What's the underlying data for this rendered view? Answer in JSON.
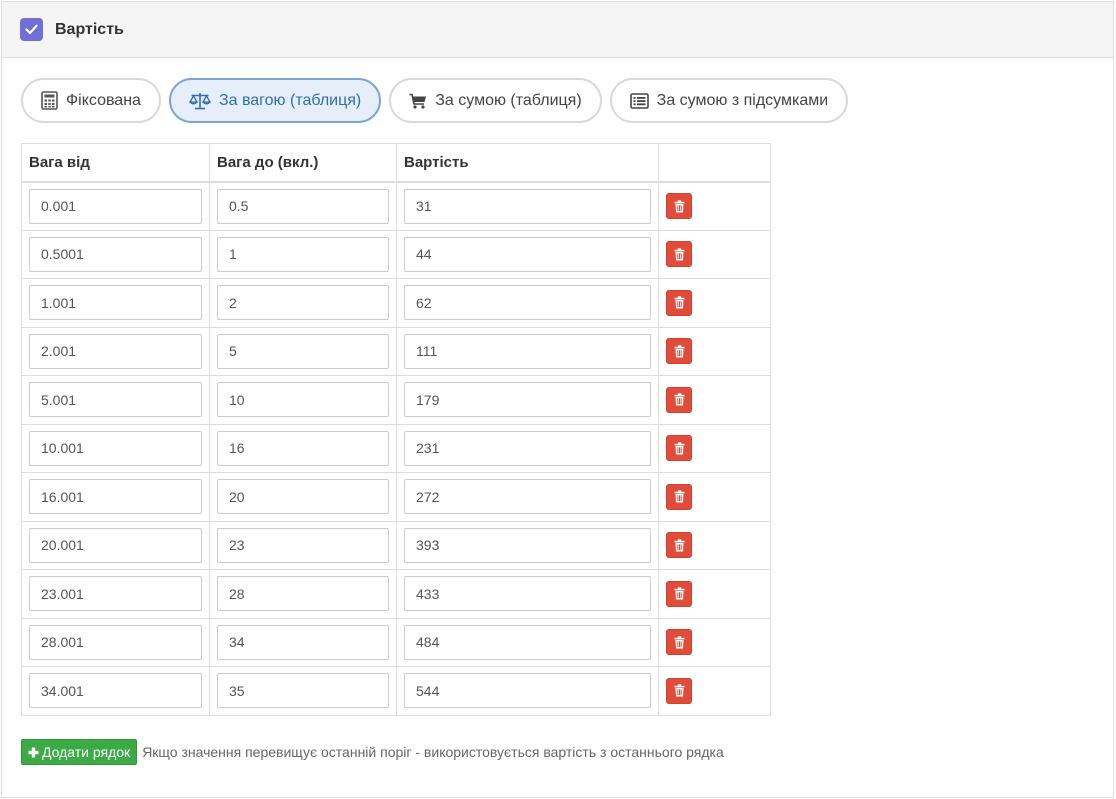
{
  "panel": {
    "title": "Вартість",
    "checked": true,
    "check_icon": "checkmark-icon"
  },
  "tabs": [
    {
      "label": "Фіксована",
      "icon": "calculator-icon",
      "active": false
    },
    {
      "label": "За вагою (таблиця)",
      "icon": "balance-scale-icon",
      "active": true
    },
    {
      "label": "За сумою (таблиця)",
      "icon": "shopping-cart-icon",
      "active": false
    },
    {
      "label": "За сумою з підсумками",
      "icon": "list-alt-icon",
      "active": false
    }
  ],
  "table": {
    "headers": [
      "Вага від",
      "Вага до (вкл.)",
      "Вартість",
      ""
    ],
    "rows": [
      {
        "from": "0.001",
        "to": "0.5",
        "cost": "31"
      },
      {
        "from": "0.5001",
        "to": "1",
        "cost": "44"
      },
      {
        "from": "1.001",
        "to": "2",
        "cost": "62"
      },
      {
        "from": "2.001",
        "to": "5",
        "cost": "111"
      },
      {
        "from": "5.001",
        "to": "10",
        "cost": "179"
      },
      {
        "from": "10.001",
        "to": "16",
        "cost": "231"
      },
      {
        "from": "16.001",
        "to": "20",
        "cost": "272"
      },
      {
        "from": "20.001",
        "to": "23",
        "cost": "393"
      },
      {
        "from": "23.001",
        "to": "28",
        "cost": "433"
      },
      {
        "from": "28.001",
        "to": "34",
        "cost": "484"
      },
      {
        "from": "34.001",
        "to": "35",
        "cost": "544"
      }
    ],
    "delete_icon": "trash-icon"
  },
  "footer": {
    "add_label": "Додати рядок",
    "add_icon": "plus-icon",
    "hint": "Якщо значення перевищує останній поріг - використовується вартість з останнього рядка"
  },
  "colors": {
    "accent_check": "#6f6fd6",
    "active_tab_bg": "#e5eef9",
    "active_tab_border": "#79a6d3",
    "delete_red": "#e04b3a",
    "add_green": "#3cab46"
  }
}
